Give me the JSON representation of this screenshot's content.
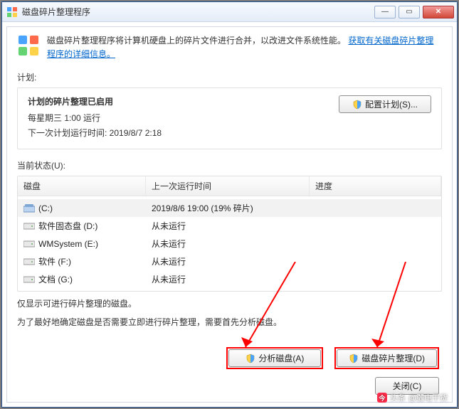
{
  "window": {
    "title": "磁盘碎片整理程序"
  },
  "intro": {
    "text_a": "磁盘碎片整理程序将计算机硬盘上的碎片文件进行合并，以改进文件系统性能。",
    "link": "获取有关磁盘碎片整理程序的详细信息。"
  },
  "schedule": {
    "label": "计划:",
    "heading": "计划的碎片整理已启用",
    "line1": "每星期三 1:00 运行",
    "line2": "下一次计划运行时间: 2019/8/7 2:18",
    "button": "配置计划(S)..."
  },
  "status_label": "当前状态(U):",
  "columns": {
    "c1": "磁盘",
    "c2": "上一次运行时间",
    "c3": "进度"
  },
  "rows": [
    {
      "name": "(C:)",
      "last": "2019/8/6 19:00 (19% 碎片)",
      "prog": "",
      "type": "hdd",
      "selected": true
    },
    {
      "name": "软件固态盘 (D:)",
      "last": "从未运行",
      "prog": "",
      "type": "drv"
    },
    {
      "name": "WMSystem (E:)",
      "last": "从未运行",
      "prog": "",
      "type": "drv"
    },
    {
      "name": "软件 (F:)",
      "last": "从未运行",
      "prog": "",
      "type": "drv"
    },
    {
      "name": "文档 (G:)",
      "last": "从未运行",
      "prog": "",
      "type": "drv"
    }
  ],
  "note1": "仅显示可进行碎片整理的磁盘。",
  "note2": "为了最好地确定磁盘是否需要立即进行碎片整理，需要首先分析磁盘。",
  "actions": {
    "analyze": "分析磁盘(A)",
    "defrag": "磁盘碎片整理(D)"
  },
  "close": "关闭(C)",
  "watermark": {
    "prefix": "头条",
    "author": "@弱电干货"
  }
}
